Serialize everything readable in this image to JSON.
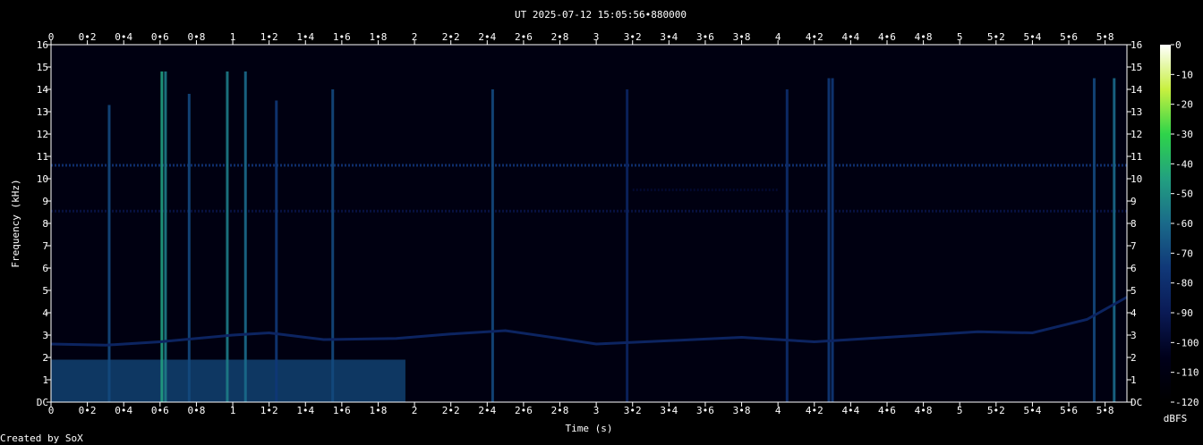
{
  "chart_data": {
    "type": "heatmap",
    "title": "UT 2025-07-12 15:05:56•880000",
    "xlabel": "Time (s)",
    "ylabel": "Frequency (kHz)",
    "credit": "Created by SoX",
    "colorbar_label": "dBFS",
    "xlim": [
      0,
      5.92
    ],
    "ylim": [
      0,
      16
    ],
    "x_ticks": [
      {
        "v": 0,
        "t": "0"
      },
      {
        "v": 0.2,
        "t": "0•2"
      },
      {
        "v": 0.4,
        "t": "0•4"
      },
      {
        "v": 0.6,
        "t": "0•6"
      },
      {
        "v": 0.8,
        "t": "0•8"
      },
      {
        "v": 1,
        "t": "1"
      },
      {
        "v": 1.2,
        "t": "1•2"
      },
      {
        "v": 1.4,
        "t": "1•4"
      },
      {
        "v": 1.6,
        "t": "1•6"
      },
      {
        "v": 1.8,
        "t": "1•8"
      },
      {
        "v": 2,
        "t": "2"
      },
      {
        "v": 2.2,
        "t": "2•2"
      },
      {
        "v": 2.4,
        "t": "2•4"
      },
      {
        "v": 2.6,
        "t": "2•6"
      },
      {
        "v": 2.8,
        "t": "2•8"
      },
      {
        "v": 3,
        "t": "3"
      },
      {
        "v": 3.2,
        "t": "3•2"
      },
      {
        "v": 3.4,
        "t": "3•4"
      },
      {
        "v": 3.6,
        "t": "3•6"
      },
      {
        "v": 3.8,
        "t": "3•8"
      },
      {
        "v": 4,
        "t": "4"
      },
      {
        "v": 4.2,
        "t": "4•2"
      },
      {
        "v": 4.4,
        "t": "4•4"
      },
      {
        "v": 4.6,
        "t": "4•6"
      },
      {
        "v": 4.8,
        "t": "4•8"
      },
      {
        "v": 5,
        "t": "5"
      },
      {
        "v": 5.2,
        "t": "5•2"
      },
      {
        "v": 5.4,
        "t": "5•4"
      },
      {
        "v": 5.6,
        "t": "5•6"
      },
      {
        "v": 5.8,
        "t": "5•8"
      }
    ],
    "y_ticks": [
      {
        "v": 0,
        "t": "DC"
      },
      {
        "v": 1,
        "t": "1"
      },
      {
        "v": 2,
        "t": "2"
      },
      {
        "v": 3,
        "t": "3"
      },
      {
        "v": 4,
        "t": "4"
      },
      {
        "v": 5,
        "t": "5"
      },
      {
        "v": 6,
        "t": "6"
      },
      {
        "v": 7,
        "t": "7"
      },
      {
        "v": 8,
        "t": "8"
      },
      {
        "v": 9,
        "t": "9"
      },
      {
        "v": 10,
        "t": "10"
      },
      {
        "v": 11,
        "t": "11"
      },
      {
        "v": 12,
        "t": "12"
      },
      {
        "v": 13,
        "t": "13"
      },
      {
        "v": 14,
        "t": "14"
      },
      {
        "v": 15,
        "t": "15"
      },
      {
        "v": 16,
        "t": "16"
      }
    ],
    "colorbar_ticks": [
      {
        "v": 0,
        "t": "0"
      },
      {
        "v": -10,
        "t": "-10"
      },
      {
        "v": -20,
        "t": "-20"
      },
      {
        "v": -30,
        "t": "-30"
      },
      {
        "v": -40,
        "t": "-40"
      },
      {
        "v": -50,
        "t": "-50"
      },
      {
        "v": -60,
        "t": "-60"
      },
      {
        "v": -70,
        "t": "-70"
      },
      {
        "v": -80,
        "t": "-80"
      },
      {
        "v": -90,
        "t": "-90"
      },
      {
        "v": -100,
        "t": "-100"
      },
      {
        "v": -110,
        "t": "-110"
      },
      {
        "v": -120,
        "t": "-120"
      }
    ],
    "colorbar_range": [
      -120,
      0
    ],
    "colormap": [
      "#000000",
      "#00001a",
      "#0a1a55",
      "#103878",
      "#1a6a8a",
      "#22a080",
      "#2ed44a",
      "#c8f040",
      "#ffffff"
    ],
    "background_level_dbfs": -110,
    "tones": [
      {
        "f": 10.6,
        "t0": 0,
        "t1": 5.92,
        "level": -80,
        "label": "10.6 kHz line"
      },
      {
        "f": 8.55,
        "t0": 0,
        "t1": 5.92,
        "level": -95,
        "label": "8.5 kHz line"
      },
      {
        "f": 9.5,
        "t0": 3.2,
        "t1": 4.0,
        "level": -100,
        "label": "9.5 kHz segment"
      }
    ],
    "sweep": {
      "level": -85,
      "points": [
        [
          0,
          2.6
        ],
        [
          0.3,
          2.55
        ],
        [
          0.6,
          2.7
        ],
        [
          1.0,
          3.0
        ],
        [
          1.2,
          3.1
        ],
        [
          1.5,
          2.8
        ],
        [
          1.9,
          2.85
        ],
        [
          2.2,
          3.05
        ],
        [
          2.5,
          3.2
        ],
        [
          2.8,
          2.85
        ],
        [
          3.0,
          2.6
        ],
        [
          3.4,
          2.75
        ],
        [
          3.8,
          2.9
        ],
        [
          4.2,
          2.7
        ],
        [
          4.5,
          2.85
        ],
        [
          4.8,
          3.0
        ],
        [
          5.1,
          3.15
        ],
        [
          5.4,
          3.1
        ],
        [
          5.7,
          3.7
        ],
        [
          5.92,
          4.7
        ]
      ]
    },
    "low_band": {
      "t0": 0,
      "t1": 1.95,
      "f0": 0,
      "f1": 1.9,
      "level": -70
    },
    "transients": [
      {
        "t": 0.32,
        "fmax": 13.3,
        "level": -70
      },
      {
        "t": 0.61,
        "fmax": 14.8,
        "level": -45
      },
      {
        "t": 0.63,
        "fmax": 14.8,
        "level": -55
      },
      {
        "t": 0.76,
        "fmax": 13.8,
        "level": -70
      },
      {
        "t": 0.97,
        "fmax": 14.8,
        "level": -55
      },
      {
        "t": 1.07,
        "fmax": 14.8,
        "level": -60
      },
      {
        "t": 1.24,
        "fmax": 13.5,
        "level": -75
      },
      {
        "t": 1.55,
        "fmax": 14.0,
        "level": -70
      },
      {
        "t": 2.43,
        "fmax": 14.0,
        "level": -70
      },
      {
        "t": 3.17,
        "fmax": 14.0,
        "level": -85
      },
      {
        "t": 4.05,
        "fmax": 14.0,
        "level": -80
      },
      {
        "t": 4.28,
        "fmax": 14.5,
        "level": -75
      },
      {
        "t": 4.3,
        "fmax": 14.5,
        "level": -75
      },
      {
        "t": 5.74,
        "fmax": 14.5,
        "level": -70
      },
      {
        "t": 5.85,
        "fmax": 14.5,
        "level": -60
      }
    ]
  }
}
